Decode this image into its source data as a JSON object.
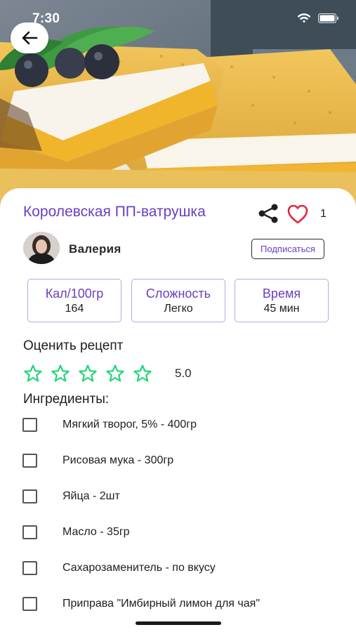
{
  "status_bar": {
    "time": "7:30"
  },
  "recipe": {
    "title": "Королевская ПП-ватрушка",
    "likes": "1"
  },
  "author": {
    "name": "Валерия",
    "subscribe_label": "Подписаться"
  },
  "stats": [
    {
      "label": "Кал/100гр",
      "value": "164"
    },
    {
      "label": "Сложность",
      "value": "Легко"
    },
    {
      "label": "Время",
      "value": "45 мин"
    }
  ],
  "rating": {
    "title": "Оценить рецепт",
    "value": "5.0",
    "stars_total": 5,
    "star_color": "#1fd678"
  },
  "ingredients": {
    "title": "Ингредиенты:",
    "items": [
      {
        "text": "Мягкий творог, 5% - 400гр",
        "checked": false
      },
      {
        "text": "Рисовая мука - 300гр",
        "checked": false
      },
      {
        "text": "Яйца - 2шт",
        "checked": false
      },
      {
        "text": "Масло - 35гр",
        "checked": false
      },
      {
        "text": "Сахарозаменитель - по вкусу",
        "checked": false
      },
      {
        "text": "Приправа \"Имбирный лимон для чая\"",
        "checked": false
      }
    ]
  },
  "colors": {
    "accent": "#6a3fc1",
    "heart": "#e0283c",
    "stat_border": "#b8a8e2"
  },
  "icons": {
    "back": "arrow-left-icon",
    "share": "share-icon",
    "like": "heart-icon",
    "rate": "star-outline-icon"
  }
}
